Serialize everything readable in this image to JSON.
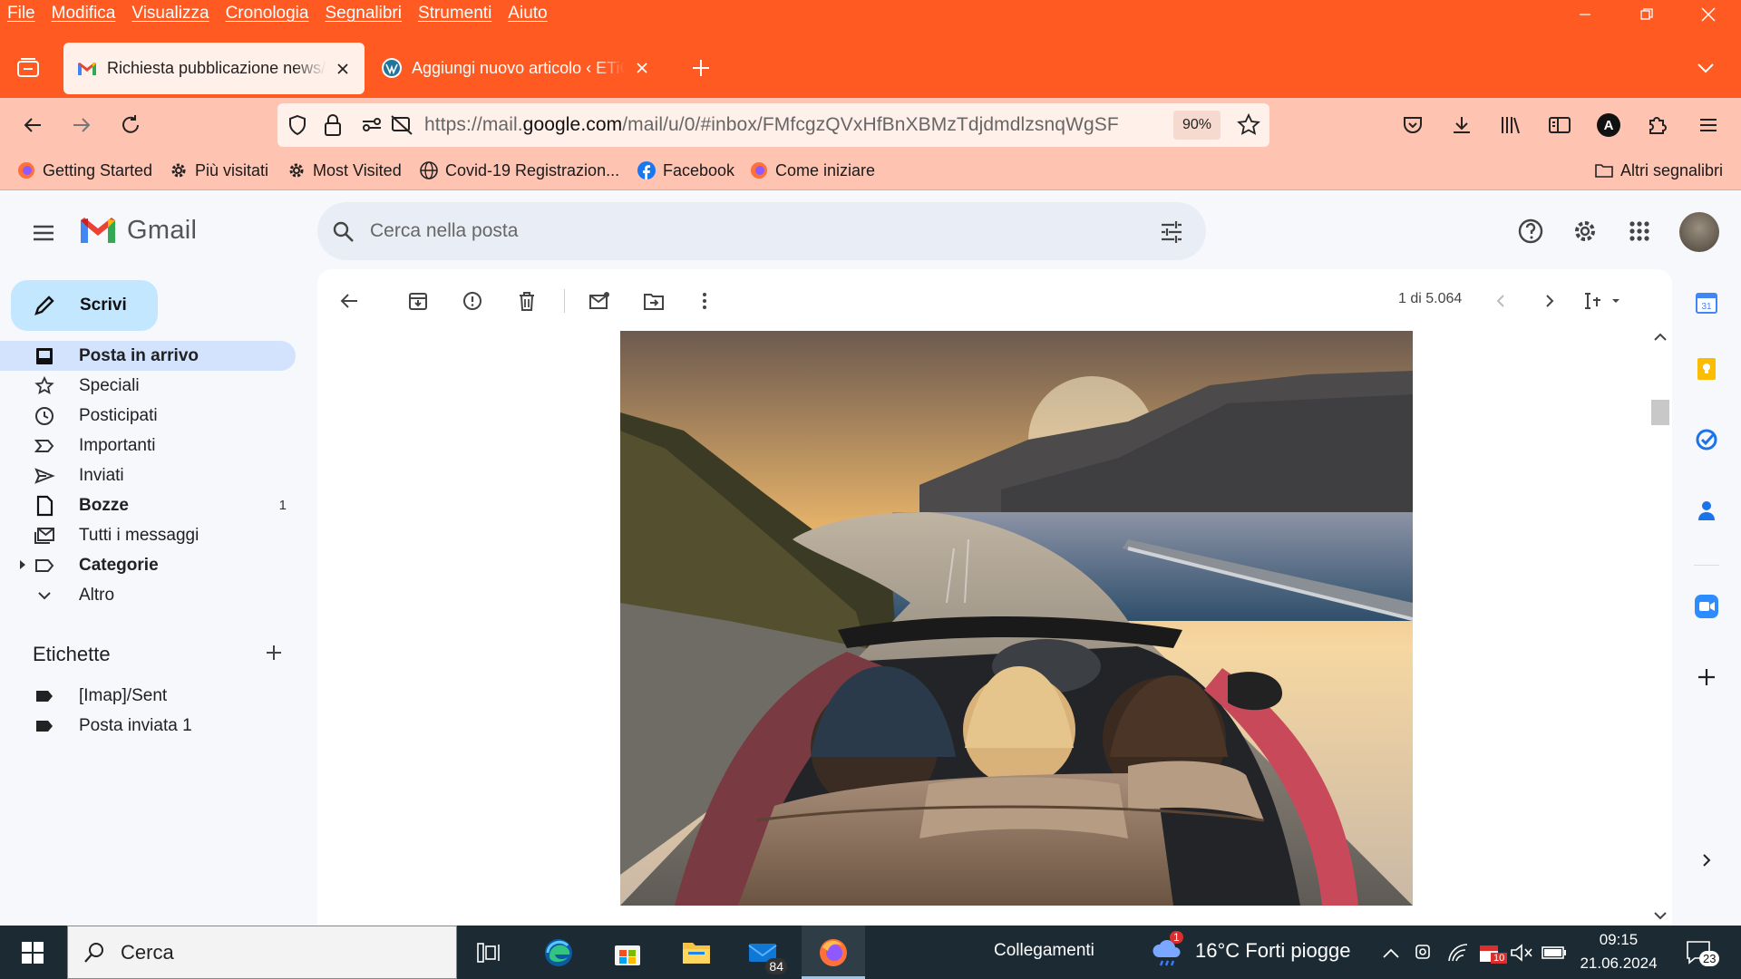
{
  "menu": [
    "File",
    "Modifica",
    "Visualizza",
    "Cronologia",
    "Segnalibri",
    "Strumenti",
    "Aiuto"
  ],
  "tabs": [
    {
      "title": "Richiesta pubblicazione news/in",
      "active": true
    },
    {
      "title": "Aggiungi nuovo articolo ‹ ETiCi",
      "active": false
    }
  ],
  "nav": {
    "url_prefix": "https://mail.",
    "url_domain": "google.com",
    "url_path": "/mail/u/0/#inbox/FMfcgzQVxHfBnXBMzTdjdmdlzsnqWgSF",
    "zoom": "90%",
    "account_initial": "A"
  },
  "bookmarks": [
    {
      "label": "Getting Started"
    },
    {
      "label": "Più visitati"
    },
    {
      "label": "Most Visited"
    },
    {
      "label": "Covid-19 Registrazion..."
    },
    {
      "label": "Facebook"
    },
    {
      "label": "Come iniziare"
    }
  ],
  "other_bookmarks": "Altri segnalibri",
  "gmail": {
    "logo_text": "Gmail",
    "search_placeholder": "Cerca nella posta",
    "compose": "Scrivi",
    "folders": [
      {
        "label": "Posta in arrivo",
        "count": ""
      },
      {
        "label": "Speciali",
        "count": ""
      },
      {
        "label": "Posticipati",
        "count": ""
      },
      {
        "label": "Importanti",
        "count": ""
      },
      {
        "label": "Inviati",
        "count": ""
      },
      {
        "label": "Bozze",
        "count": "1"
      },
      {
        "label": "Tutti i messaggi",
        "count": ""
      },
      {
        "label": "Categorie",
        "count": ""
      },
      {
        "label": "Altro",
        "count": ""
      }
    ],
    "labels_heading": "Etichette",
    "labels": [
      {
        "label": "[Imap]/Sent"
      },
      {
        "label": "Posta inviata 1"
      }
    ],
    "pager": "1 di 5.064"
  },
  "taskbar": {
    "search": "Cerca",
    "mail_badge": "84",
    "links": "Collegamenti",
    "weather": "16°C  Forti piogge",
    "weather_badge": "1",
    "tray_badge": "10",
    "time": "09:15",
    "date": "21.06.2024",
    "notif": "23"
  },
  "colors": {
    "firefox_accent": "#ff5a22",
    "nav_bg": "#ffc3b2",
    "gmail_bg": "#f6f8fc",
    "selected": "#d3e3fd",
    "compose": "#c2e7ff",
    "taskbar": "#1c2b33"
  }
}
